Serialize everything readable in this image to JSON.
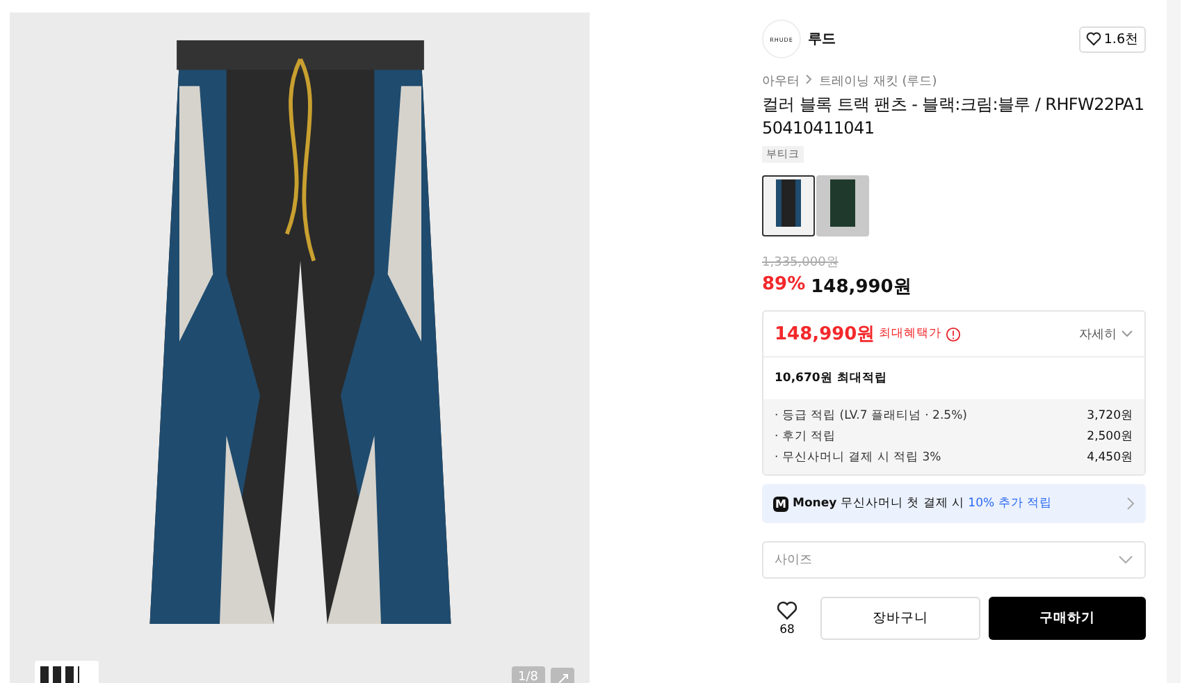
{
  "gallery": {
    "counter": "1/8"
  },
  "brand": {
    "logo": "RHUDE",
    "name": "루드",
    "likes": "1.6천"
  },
  "breadcrumb": [
    "아우터",
    "트레이닝 재킷 (루드)"
  ],
  "title": "컬러 블록 트랙 팬츠 - 블랙:크림:블루 / RHFW22PA150410411041",
  "tag": "부티크",
  "swatches": [
    {
      "selected": true
    },
    {
      "selected": false
    }
  ],
  "price": {
    "original": "1,335,000원",
    "discount": "89%",
    "current": "148,990원"
  },
  "benefit": {
    "price": "148,990원",
    "label": "최대혜택가",
    "detail": "자세히",
    "points_total": "10,670원 최대적립",
    "rows": [
      {
        "label": "· 등급 적립 (LV.7 플래티넘 · 2.5%)",
        "value": "3,720원"
      },
      {
        "label": "· 후기 적립",
        "value": "2,500원"
      },
      {
        "label": "· 무신사머니 결제 시 적립 3%",
        "value": "4,450원"
      }
    ]
  },
  "money_banner": {
    "badge": "M",
    "brand": "Money",
    "text": "무신사머니 첫 결제 시 ",
    "highlight": "10% 추가 적립"
  },
  "size_select": {
    "placeholder": "사이즈"
  },
  "actions": {
    "likes": "68",
    "cart": "장바구니",
    "buy": "구매하기"
  }
}
